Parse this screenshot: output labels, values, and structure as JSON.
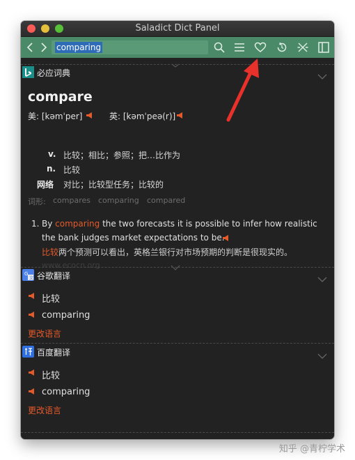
{
  "window": {
    "title": "Saladict Dict Panel"
  },
  "toolbar": {
    "search_value": "comparing"
  },
  "bing": {
    "name": "必应词典",
    "word": "compare",
    "phonetics": [
      {
        "label": "美: [kəmˈper]"
      },
      {
        "label": "英: [kəmˈpeə(r)]"
      }
    ],
    "defs": [
      {
        "pos": "v.",
        "meaning": "比较；相比；参照；把…比作为"
      },
      {
        "pos": "n.",
        "meaning": "比较"
      },
      {
        "pos": "网络",
        "meaning": "对比；比较型任务；比较的"
      }
    ],
    "forms_label": "词形:",
    "forms": [
      "compares",
      "comparing",
      "compared"
    ],
    "example": {
      "num": "1.",
      "before": "By",
      "highlight": "comparing",
      "after": "the two forecasts it is possible to infer how realistic",
      "line2": "the bank judges market expectations to be.",
      "cn_highlight": "比较",
      "cn_rest": "两个预测可以看出，英格兰银行对市场预期的判断是很现实的。",
      "source": "www.ecocn.org"
    }
  },
  "google": {
    "name": "谷歌翻译",
    "source_text": "比较",
    "translation": "comparing",
    "change_lang": "更改语言"
  },
  "baidu": {
    "name": "百度翻译",
    "source_text": "比较",
    "translation": "comparing",
    "change_lang": "更改语言"
  },
  "watermark": "知乎 @青柠学术",
  "colors": {
    "toolbar": "#4b8a68",
    "accent": "#e55a2b",
    "panel": "#222222",
    "annotation_arrow": "#e8312a"
  }
}
